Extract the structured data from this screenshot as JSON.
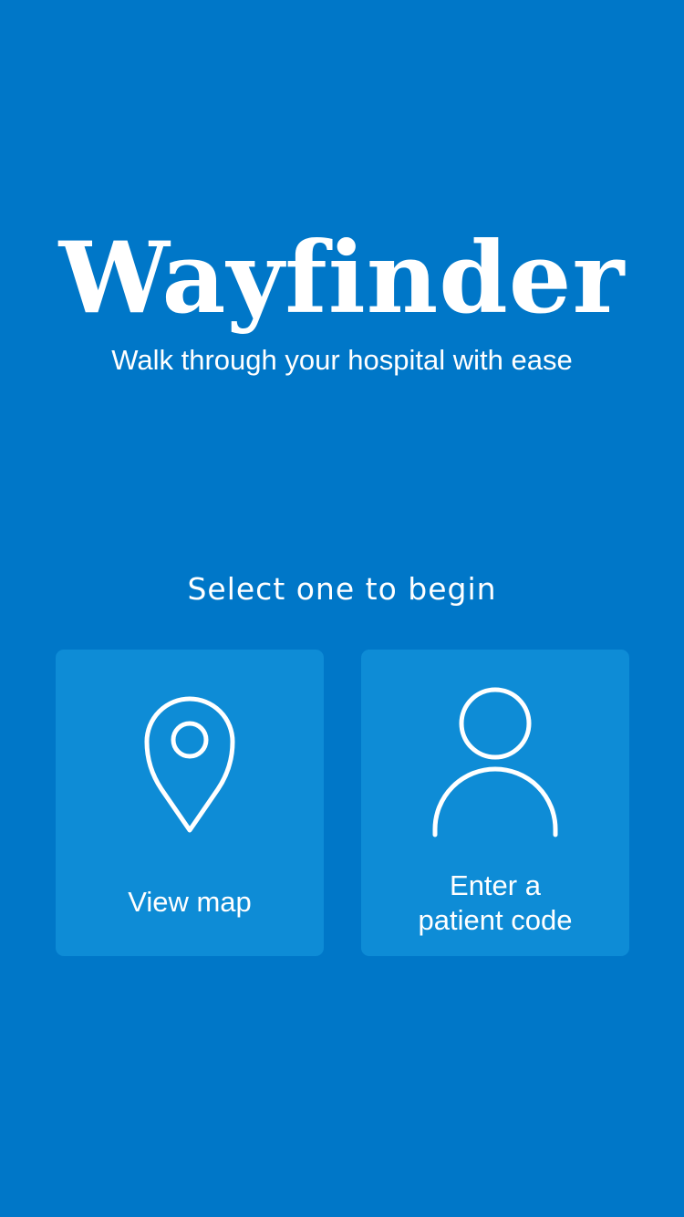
{
  "header": {
    "title": "Wayfinder",
    "tagline": "Walk through your hospital with ease"
  },
  "prompt": "Select one to begin",
  "options": [
    {
      "label": "View map",
      "icon": "map-pin-icon"
    },
    {
      "label": "Enter a\npatient code",
      "icon": "person-icon"
    }
  ],
  "colors": {
    "background": "#0077C8",
    "card": "#0E8CD6",
    "text": "#FFFFFF"
  }
}
